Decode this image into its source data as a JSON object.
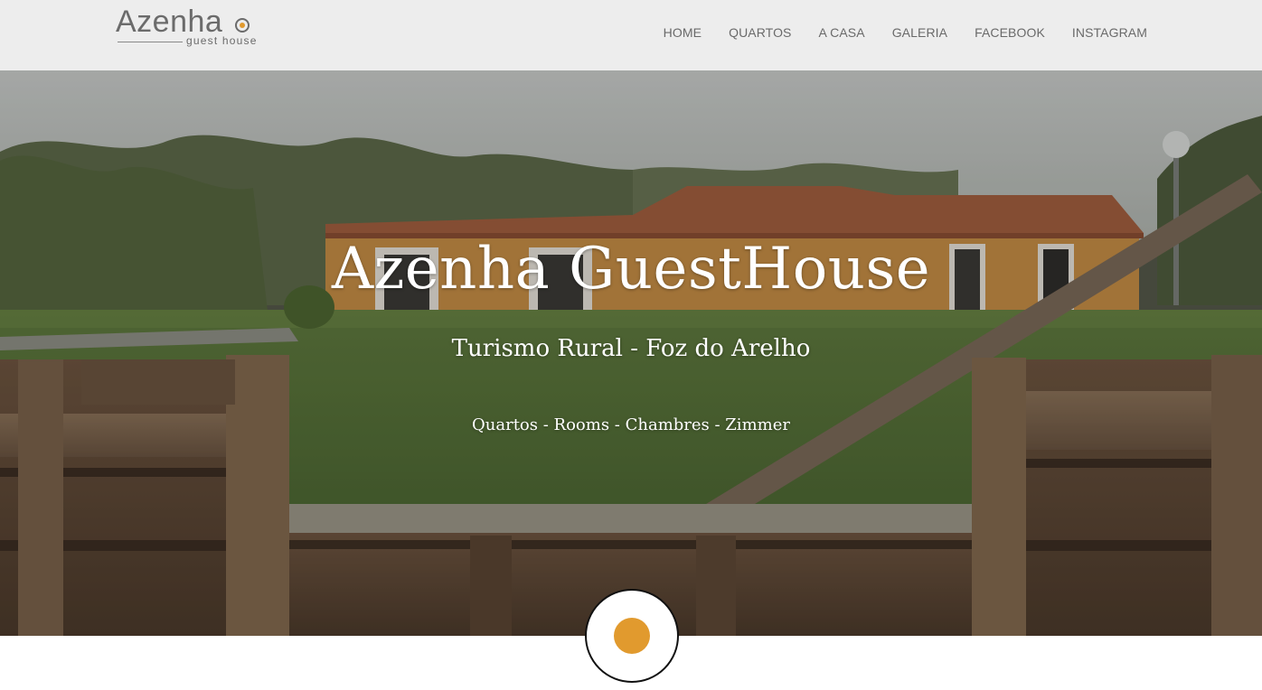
{
  "logo": {
    "word": "Azenha",
    "subtitle": "guest house"
  },
  "nav": {
    "items": [
      {
        "label": "HOME"
      },
      {
        "label": "QUARTOS"
      },
      {
        "label": "A CASA"
      },
      {
        "label": "GALERIA"
      },
      {
        "label": "FACEBOOK"
      },
      {
        "label": "INSTAGRAM"
      }
    ]
  },
  "hero": {
    "title": "Azenha GuestHouse",
    "subtitle": "Turismo Rural - Foz do Arelho",
    "tagline": "Quartos - Rooms - Chambres - Zimmer"
  },
  "colors": {
    "accent": "#e19a2e",
    "header_bg": "#ededed",
    "nav_text": "#6a6a6a"
  },
  "icons": {
    "logo_mark": "orange-dot-circle-icon",
    "scroll_button": "orange-dot-icon"
  }
}
